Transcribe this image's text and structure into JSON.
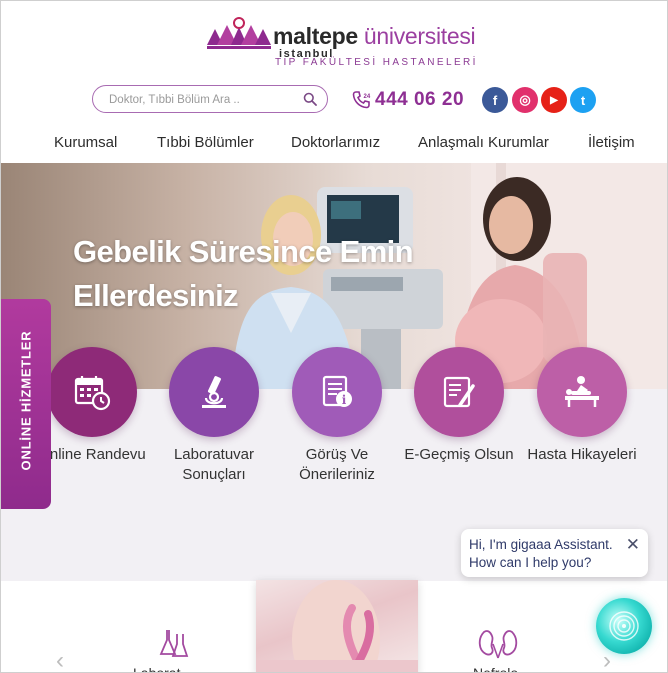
{
  "brand": {
    "name_bold": "maltepe",
    "name_light": "üniversitesi",
    "city": "istanbul",
    "subtitle": "TIP FAKÜLTESİ HASTANELERİ"
  },
  "search": {
    "placeholder": "Doktor, Tıbbi Bölüm Ara .."
  },
  "phone": {
    "number": "444 06 20",
    "badge": "24"
  },
  "social": [
    {
      "name": "facebook",
      "glyph": "f",
      "color": "#3b5998"
    },
    {
      "name": "instagram",
      "glyph": "◎",
      "color": "#e1306c"
    },
    {
      "name": "youtube",
      "glyph": "▶",
      "color": "#e62117"
    },
    {
      "name": "twitter",
      "glyph": "t",
      "color": "#1da1f2"
    }
  ],
  "nav": [
    "Kurumsal",
    "Tıbbi Bölümler",
    "Doktorlarımız",
    "Anlaşmalı Kurumlar",
    "İletişim"
  ],
  "hero": {
    "title": "Gebelik Süresince Emin Ellerdesiniz"
  },
  "side_tab": "ONLİNE HİZMETLER",
  "services": [
    {
      "label": "Online Randevu",
      "icon": "calendar-icon",
      "color": "#8e2a78"
    },
    {
      "label": "Laboratuvar Sonuçları",
      "icon": "microscope-icon",
      "color": "#8a47a8"
    },
    {
      "label": "Görüş Ve Önerileriniz",
      "icon": "document-info-icon",
      "color": "#a05bb8"
    },
    {
      "label": "E-Geçmiş Olsun",
      "icon": "letter-pen-icon",
      "color": "#b04f9c"
    },
    {
      "label": "Hasta Hikayeleri",
      "icon": "patient-massage-icon",
      "color": "#bd5fa7"
    }
  ],
  "chat": {
    "line1": "Hi, I'm gigaaa Assistant.",
    "line2": "How can I help you?"
  },
  "bottom": {
    "left_label": "Laborat...",
    "right_label": "Nefrolo..."
  }
}
